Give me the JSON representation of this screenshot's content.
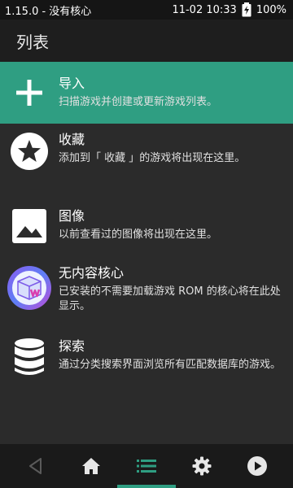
{
  "status": {
    "left_text": "1.15.0 - 没有核心",
    "datetime": "11-02 10:33",
    "battery": "100%"
  },
  "appbar": {
    "title": "列表"
  },
  "entries": [
    {
      "title": "导入",
      "subtitle": "扫描游戏并创建或更新游戏列表。",
      "icon": "plus-icon"
    },
    {
      "title": "收藏",
      "subtitle": "添加到「 收藏 」的游戏将出现在这里。",
      "icon": "star-icon"
    },
    {
      "title": "图像",
      "subtitle": "以前查看过的图像将出现在这里。",
      "icon": "image-icon"
    },
    {
      "title": "无内容核心",
      "subtitle": "已安装的不需要加载游戏 ROM 的核心将在此处显示。",
      "icon": "cube-icon"
    },
    {
      "title": "探索",
      "subtitle": "通过分类搜索界面浏览所有匹配数据库的游戏。",
      "icon": "database-icon"
    }
  ],
  "bottom_nav": [
    {
      "name": "back",
      "icon": "back-triangle-icon"
    },
    {
      "name": "home",
      "icon": "home-icon"
    },
    {
      "name": "playlists",
      "icon": "list-icon",
      "active": true
    },
    {
      "name": "settings",
      "icon": "gear-icon"
    },
    {
      "name": "run",
      "icon": "play-circle-icon"
    }
  ],
  "colors": {
    "accent": "#2f9e82",
    "background": "#2b2b2b",
    "appbar": "#1e1e1e",
    "statusbar": "#151515",
    "navbar": "#1a1a1a"
  }
}
